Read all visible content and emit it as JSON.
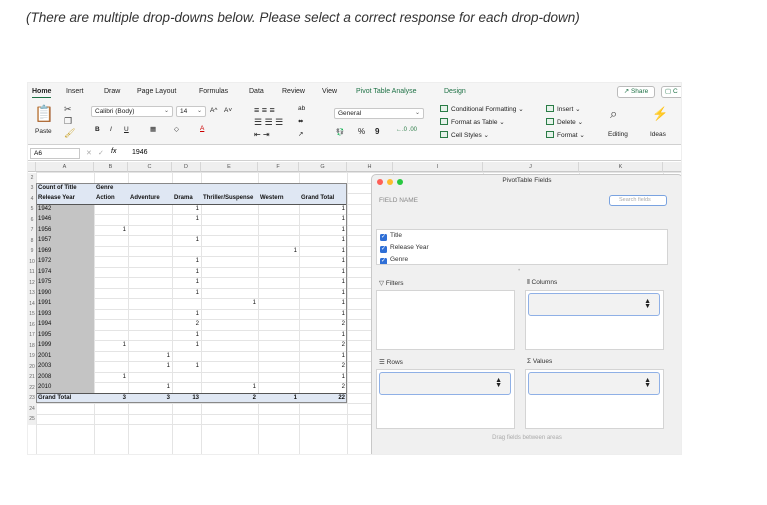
{
  "instruction": "(There are multiple drop-downs below. Please select a correct response for each drop-down)",
  "ribbon_tabs": [
    "Home",
    "Insert",
    "Draw",
    "Page Layout",
    "Formulas",
    "Data",
    "Review",
    "View",
    "Pivot Table Analyse",
    "Design"
  ],
  "share_label": "Share",
  "comment_label": "C",
  "font_name": "Calibri (Body)",
  "font_size": "14",
  "number_format": "General",
  "paste_label": "Paste",
  "bold": "B",
  "italic": "I",
  "underline": "U",
  "grow_font": "A^",
  "shrink_font": "A˅",
  "percent": "%",
  "comma": "9",
  "cond_format": "Conditional Formatting",
  "format_table": "Format as Table",
  "cell_styles": "Cell Styles",
  "insert_label": "Insert",
  "delete_label": "Delete",
  "format_label": "Format",
  "editing_label": "Editing",
  "ideas_label": "Ideas",
  "name_box": "A6",
  "fx": "fx",
  "formula_value": "1946",
  "columns": [
    "A",
    "B",
    "C",
    "D",
    "E",
    "F",
    "G",
    "H",
    "I",
    "J",
    "K",
    "L"
  ],
  "row_numbers": [
    "2",
    "3",
    "4",
    "5",
    "6",
    "7",
    "8",
    "9",
    "10",
    "11",
    "12",
    "13",
    "14",
    "15",
    "16",
    "17",
    "18",
    "19",
    "20",
    "21",
    "22",
    "23",
    "24",
    "25"
  ],
  "pivot": {
    "count_label": "Count of Title",
    "genre_label": "Genre",
    "row_label": "Release Year",
    "col_headers": [
      "Action",
      "Adventure",
      "Drama",
      "Thriller/Suspense",
      "Western",
      "Grand Total"
    ],
    "rows": [
      {
        "year": "1942",
        "vals": [
          "",
          "",
          "1",
          "",
          "",
          "1"
        ]
      },
      {
        "year": "1946",
        "vals": [
          "",
          "",
          "1",
          "",
          "",
          "1"
        ]
      },
      {
        "year": "1956",
        "vals": [
          "1",
          "",
          "",
          "",
          "",
          "1"
        ]
      },
      {
        "year": "1957",
        "vals": [
          "",
          "",
          "1",
          "",
          "",
          "1"
        ]
      },
      {
        "year": "1969",
        "vals": [
          "",
          "",
          "",
          "",
          "1",
          "1"
        ]
      },
      {
        "year": "1972",
        "vals": [
          "",
          "",
          "1",
          "",
          "",
          "1"
        ]
      },
      {
        "year": "1974",
        "vals": [
          "",
          "",
          "1",
          "",
          "",
          "1"
        ]
      },
      {
        "year": "1975",
        "vals": [
          "",
          "",
          "1",
          "",
          "",
          "1"
        ]
      },
      {
        "year": "1990",
        "vals": [
          "",
          "",
          "1",
          "",
          "",
          "1"
        ]
      },
      {
        "year": "1991",
        "vals": [
          "",
          "",
          "",
          "1",
          "",
          "1"
        ]
      },
      {
        "year": "1993",
        "vals": [
          "",
          "",
          "1",
          "",
          "",
          "1"
        ]
      },
      {
        "year": "1994",
        "vals": [
          "",
          "",
          "2",
          "",
          "",
          "2"
        ]
      },
      {
        "year": "1995",
        "vals": [
          "",
          "",
          "1",
          "",
          "",
          "1"
        ]
      },
      {
        "year": "1999",
        "vals": [
          "1",
          "",
          "1",
          "",
          "",
          "2"
        ]
      },
      {
        "year": "2001",
        "vals": [
          "",
          "1",
          "",
          "",
          "",
          "1"
        ]
      },
      {
        "year": "2003",
        "vals": [
          "",
          "1",
          "1",
          "",
          "",
          "2"
        ]
      },
      {
        "year": "2008",
        "vals": [
          "1",
          "",
          "",
          "",
          "",
          "1"
        ]
      },
      {
        "year": "2010",
        "vals": [
          "",
          "1",
          "",
          "1",
          "",
          "2"
        ]
      }
    ],
    "total_label": "Grand Total",
    "totals": [
      "3",
      "3",
      "13",
      "2",
      "1",
      "22"
    ]
  },
  "pane": {
    "title": "PivotTable Fields",
    "field_name": "FIELD NAME",
    "search_placeholder": "Search fields",
    "fields": [
      "Title",
      "Release Year",
      "Genre"
    ],
    "filters": "Filters",
    "columns": "Columns",
    "rows": "Rows",
    "values": "Values",
    "drag_hint": "Drag fields between areas"
  }
}
